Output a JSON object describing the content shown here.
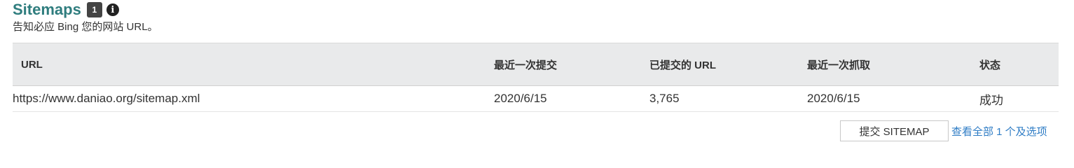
{
  "section": {
    "title": "Sitemaps",
    "count_badge": "1",
    "info_icon": "info-icon",
    "subtitle": "告知必应 Bing 您的网站 URL。"
  },
  "table": {
    "headers": {
      "url": "URL",
      "last_submitted": "最近一次提交",
      "submitted_urls": "已提交的 URL",
      "last_crawled": "最近一次抓取",
      "status": "状态"
    },
    "rows": [
      {
        "url": "https://www.daniao.org/sitemap.xml",
        "last_submitted": "2020/6/15",
        "submitted_urls": "3,765",
        "last_crawled": "2020/6/15",
        "status": "成功"
      }
    ]
  },
  "footer": {
    "submit_button_label": "提交 SITEMAP",
    "view_all_link": "查看全部 1 个及选项"
  },
  "colors": {
    "title": "#2f7d7e",
    "link": "#2e7cc5",
    "header_bg": "#e9eaeb",
    "badge_bg": "#444444"
  }
}
